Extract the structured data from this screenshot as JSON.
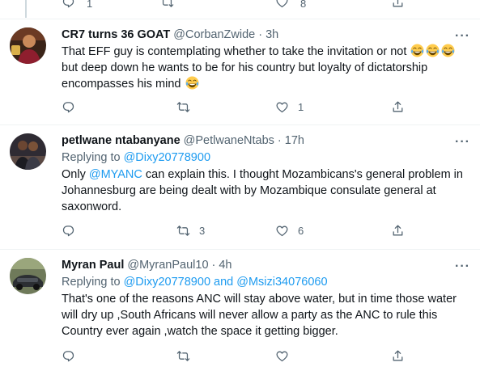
{
  "top_strip": {
    "reply_count": "1",
    "like_count": "8"
  },
  "tweets": [
    {
      "display_name": "CR7 turns 36 GOAT",
      "handle": "@CorbanZwide",
      "time": "3h",
      "text_part1": "That EFF guy is contemplating whether to take the invitation or not",
      "text_part2": "but deep down he wants to be for his country but loyalty of dictatorship encompasses his mind",
      "reply_count": "",
      "retweet_count": "",
      "like_count": "1"
    },
    {
      "display_name": "petlwane ntabanyane",
      "handle": "@PetlwaneNtabs",
      "time": "17h",
      "replying_prefix": "Replying to",
      "replying_to": "@Dixy20778900",
      "mention": "@MYANC",
      "text_before": "Only",
      "text_after": "can explain this. I thought Mozambicans's general problem in Johannesburg are being dealt with by Mozambique consulate general at saxonword.",
      "reply_count": "",
      "retweet_count": "3",
      "like_count": "6"
    },
    {
      "display_name": "Myran Paul",
      "handle": "@MyranPaul10",
      "time": "4h",
      "replying_prefix": "Replying to",
      "replying_to": "@Dixy20778900 and @Msizi34076060",
      "text": "That's one of the reasons ANC  will stay above water, but in time those water will dry up ,South Africans will never allow a party as the  ANC to rule this Country ever again ,watch the space it getting bigger.",
      "reply_count": "",
      "retweet_count": "",
      "like_count": ""
    }
  ],
  "colors": {
    "accent": "#1d9bf0",
    "muted": "#536471",
    "text": "#0f1419",
    "divider": "#eff3f4"
  },
  "icons": [
    "reply-icon",
    "retweet-icon",
    "like-icon",
    "share-icon",
    "more-icon",
    "joy-emoji"
  ]
}
